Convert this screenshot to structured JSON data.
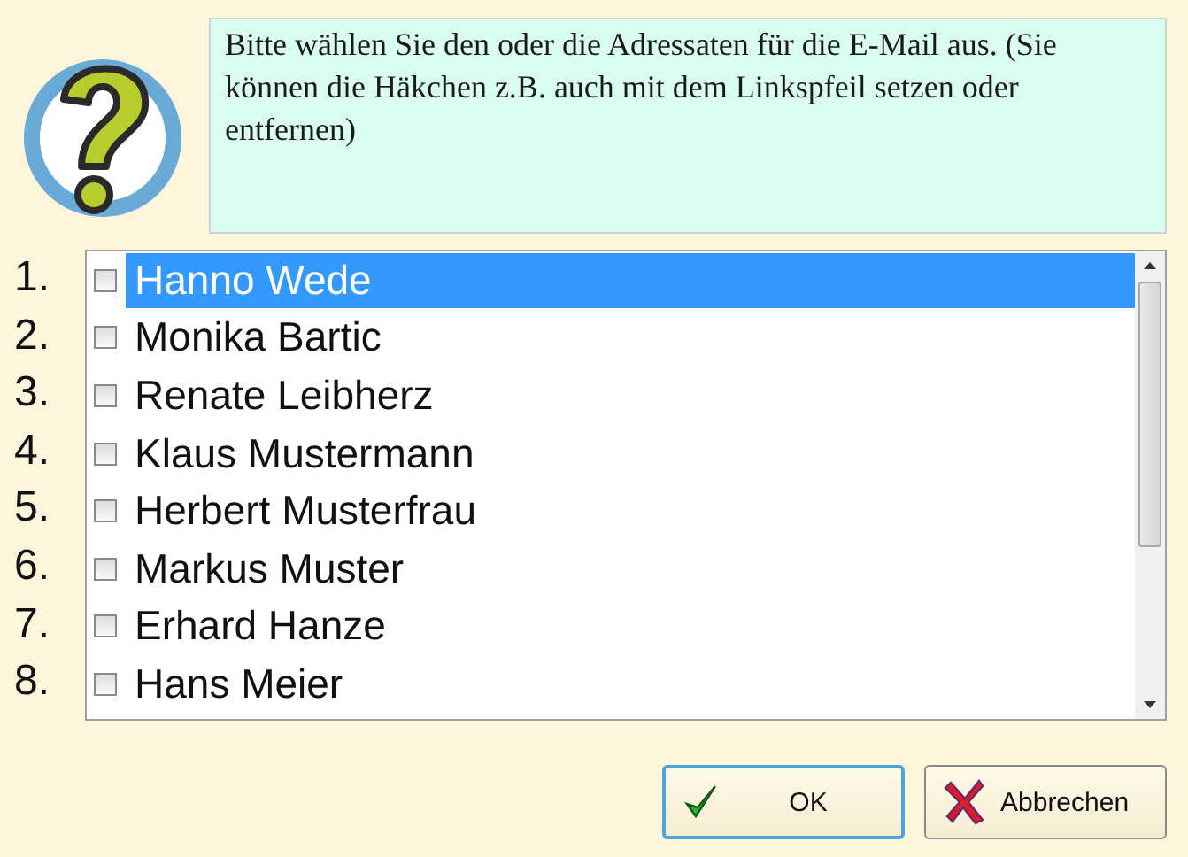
{
  "message": "Bitte wählen Sie den oder die Adressaten für die E-Mail aus. (Sie können die Häkchen z.B. auch mit dem Linkspfeil setzen oder entfernen)",
  "recipients": [
    {
      "number": "1.",
      "name": "Hanno Wede",
      "checked": false,
      "selected": true
    },
    {
      "number": "2.",
      "name": "Monika Bartic",
      "checked": false,
      "selected": false
    },
    {
      "number": "3.",
      "name": "Renate Leibherz",
      "checked": false,
      "selected": false
    },
    {
      "number": "4.",
      "name": "Klaus Mustermann",
      "checked": false,
      "selected": false
    },
    {
      "number": "5.",
      "name": "Herbert Musterfrau",
      "checked": false,
      "selected": false
    },
    {
      "number": "6.",
      "name": "Markus Muster",
      "checked": false,
      "selected": false
    },
    {
      "number": "7.",
      "name": "Erhard Hanze",
      "checked": false,
      "selected": false
    },
    {
      "number": "8.",
      "name": "Hans Meier",
      "checked": false,
      "selected": false
    }
  ],
  "buttons": [
    {
      "kind": "ok",
      "label": "OK",
      "focused": true
    },
    {
      "kind": "cancel",
      "label": "Abbrechen",
      "focused": false
    }
  ]
}
